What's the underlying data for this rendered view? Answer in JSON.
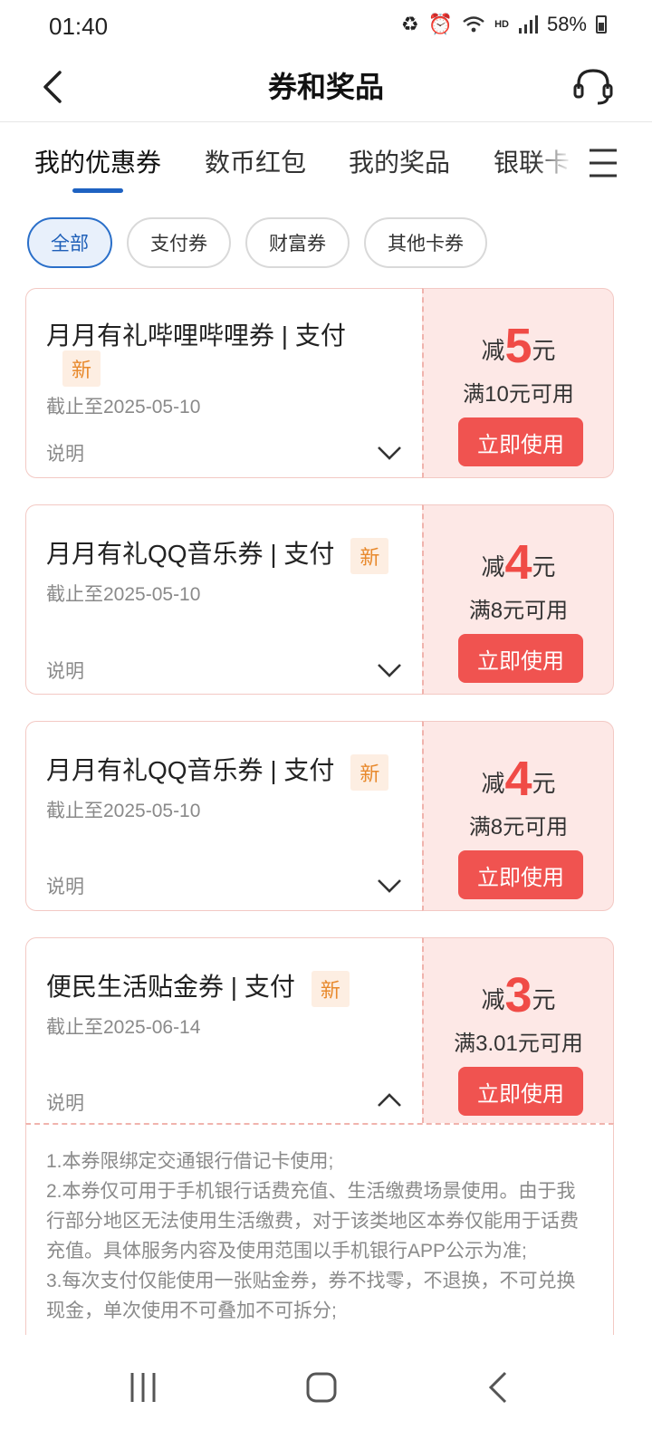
{
  "status_bar": {
    "time": "01:40",
    "network_label": "HD",
    "battery": "58%",
    "icons": [
      "recycle-icon",
      "alarm-icon",
      "wifi-icon",
      "signal-icon",
      "battery-icon"
    ]
  },
  "header": {
    "title": "券和奖品",
    "back_icon": "chevron-left-icon",
    "service_icon": "headset-icon"
  },
  "tabs": [
    {
      "label": "我的优惠券",
      "active": true
    },
    {
      "label": "数币红包",
      "active": false
    },
    {
      "label": "我的奖品",
      "active": false
    },
    {
      "label": "银联卡",
      "active": false
    }
  ],
  "filters": [
    {
      "label": "全部",
      "active": true
    },
    {
      "label": "支付券",
      "active": false
    },
    {
      "label": "财富券",
      "active": false
    },
    {
      "label": "其他卡券",
      "active": false
    }
  ],
  "coupons": [
    {
      "title": "月月有礼哔哩哔哩券 | 支付",
      "badge": "新",
      "expiry": "截止至2025-05-10",
      "desc_label": "说明",
      "amount_prefix": "减",
      "amount": "5",
      "amount_suffix": "元",
      "condition": "满10元可用",
      "button": "立即使用",
      "expanded": false
    },
    {
      "title": "月月有礼QQ音乐券 | 支付",
      "badge": "新",
      "expiry": "截止至2025-05-10",
      "desc_label": "说明",
      "amount_prefix": "减",
      "amount": "4",
      "amount_suffix": "元",
      "condition": "满8元可用",
      "button": "立即使用",
      "expanded": false
    },
    {
      "title": "月月有礼QQ音乐券 | 支付",
      "badge": "新",
      "expiry": "截止至2025-05-10",
      "desc_label": "说明",
      "amount_prefix": "减",
      "amount": "4",
      "amount_suffix": "元",
      "condition": "满8元可用",
      "button": "立即使用",
      "expanded": false
    },
    {
      "title": "便民生活贴金券 | 支付",
      "badge": "新",
      "expiry": "截止至2025-06-14",
      "desc_label": "说明",
      "amount_prefix": "减",
      "amount": "3",
      "amount_suffix": "元",
      "condition": "满3.01元可用",
      "button": "立即使用",
      "expanded": true
    }
  ],
  "details": {
    "line1": "1.本券限绑定交通银行借记卡使用;",
    "line2": "2.本券仅可用于手机银行话费充值、生活缴费场景使用。由于我行部分地区无法使用生活缴费，对于该类地区本券仅能用于话费充值。具体服务内容及使用范围以手机银行APP公示为准;",
    "line3": "3.每次支付仅能使用一张贴金券，券不找零，不退换，不可兑换现金，单次使用不可叠加不可拆分;"
  },
  "colors": {
    "accent_blue": "#1e62c2",
    "coupon_red": "#f04b46",
    "button_red": "#f05350",
    "coupon_pink_bg": "#fde8e6",
    "badge_orange": "#e8892c"
  },
  "nav_bar": [
    "recent-apps-icon",
    "home-icon",
    "back-icon"
  ]
}
